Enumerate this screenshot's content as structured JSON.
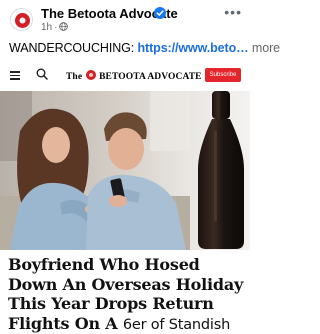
{
  "post": {
    "page_name": "The Betoota Advocate",
    "time": "1h",
    "separator": "·",
    "caption_prefix": "WANDERCOUCHING: ",
    "caption_link": "https://www.beto…",
    "more_label": " more"
  },
  "site_nav": {
    "logo_prefix": "The",
    "logo_suffix": "BETOOTA ADVOCATE",
    "subscribe_label": "Subscribe"
  },
  "article": {
    "headline_serif": "Boyfriend Who Hosed Down An Overseas Holiday This Year Drops Return Flights On A ",
    "headline_tail": "6er of Standish"
  },
  "icons": {
    "verified": "verified-badge-icon",
    "globe": "globe-icon",
    "more": "more-dots-icon",
    "menu": "hamburger-icon",
    "search": "search-icon"
  },
  "colors": {
    "link": "#1d6fe0",
    "verified": "#1877f2",
    "subscribe": "#e4262c",
    "logo_badge": "#d51f26"
  }
}
